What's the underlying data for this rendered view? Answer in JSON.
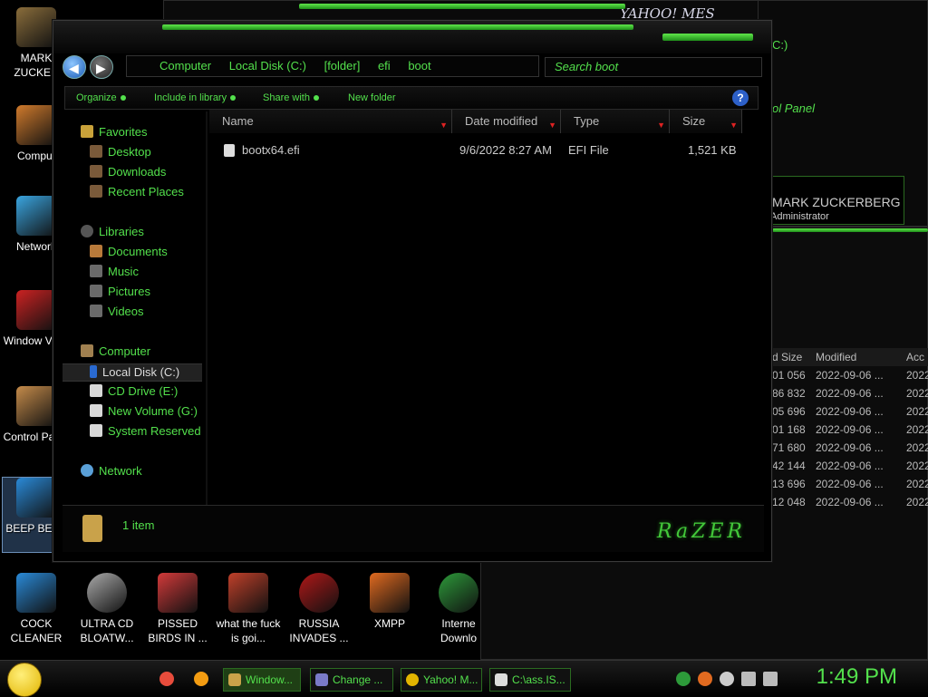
{
  "desktop_icons": [
    {
      "label": "MARK ZUCKER",
      "color": "#8a6d3b"
    },
    {
      "label": "Comput",
      "color": "#d07a2c"
    },
    {
      "label": "Network",
      "color": "#3aa5e0"
    },
    {
      "label": "Window Vista",
      "color": "#cc2222"
    },
    {
      "label": "Control Panel",
      "color": "#c58b4a"
    },
    {
      "label": "BEEP BEEP",
      "color": "#2a8ad8"
    },
    {
      "label": "COCK CLEANER",
      "color": "#2a8ad8"
    },
    {
      "label": "ULTRA CD BLOATW...",
      "color": "#aaaaaa"
    },
    {
      "label": "PISSED BIRDS IN ...",
      "color": "#d33a3a"
    },
    {
      "label": "what the fuck is goi...",
      "color": "#c0402a"
    },
    {
      "label": "RUSSIA INVADES ...",
      "color": "#b01818"
    },
    {
      "label": "XMPP",
      "color": "#e06a20"
    },
    {
      "label": "Interne Downlo",
      "color": "#2d9a3a"
    }
  ],
  "background": {
    "yahoo_title": "YAHOO! MES",
    "cpanel_path": "C:)",
    "cpanel_title": "ol Panel",
    "user_name": "MARK ZUCKERBERG",
    "user_role": "Administrator",
    "table_headers": [
      "d Size",
      "Modified",
      "Acc"
    ],
    "table_rows": [
      {
        "size": "01 056",
        "modified": "2022-09-06 ...",
        "acc": "2022"
      },
      {
        "size": "86 832",
        "modified": "2022-09-06 ...",
        "acc": "2022"
      },
      {
        "size": "05 696",
        "modified": "2022-09-06 ...",
        "acc": "2022"
      },
      {
        "size": "01 168",
        "modified": "2022-09-06 ...",
        "acc": "2022"
      },
      {
        "size": "71 680",
        "modified": "2022-09-06 ...",
        "acc": "2022"
      },
      {
        "size": "42 144",
        "modified": "2022-09-06 ...",
        "acc": "2022"
      },
      {
        "size": "13 696",
        "modified": "2022-09-06 ...",
        "acc": "2022"
      },
      {
        "size": "12 048",
        "modified": "2022-09-06 ...",
        "acc": "2022"
      }
    ]
  },
  "explorer": {
    "breadcrumb": [
      "Computer",
      "Local Disk (C:)",
      "[folder]",
      "efi",
      "boot"
    ],
    "search_placeholder": "Search boot",
    "toolbar": {
      "organize": "Organize",
      "include": "Include in library",
      "share": "Share with",
      "new_folder": "New folder",
      "help": "?"
    },
    "nav": {
      "favorites": "Favorites",
      "desktop": "Desktop",
      "downloads": "Downloads",
      "recent": "Recent Places",
      "libraries": "Libraries",
      "documents": "Documents",
      "music": "Music",
      "pictures": "Pictures",
      "videos": "Videos",
      "computer": "Computer",
      "local_disk": "Local Disk (C:)",
      "cd_drive": "CD Drive (E:)",
      "new_volume": "New Volume (G:)",
      "system_reserved": "System Reserved",
      "network": "Network"
    },
    "columns": {
      "name": "Name",
      "date": "Date modified",
      "type": "Type",
      "size": "Size"
    },
    "files": [
      {
        "name": "bootx64.efi",
        "date": "9/6/2022 8:27 AM",
        "type": "EFI File",
        "size": "1,521 KB"
      }
    ],
    "status": "1 item",
    "brand": "RaZER"
  },
  "taskbar": {
    "buttons": [
      "Window...",
      "Change ...",
      "Yahoo! M...",
      "C:\\ass.IS..."
    ],
    "clock": "1:49 PM"
  },
  "accent": "#53e04c"
}
